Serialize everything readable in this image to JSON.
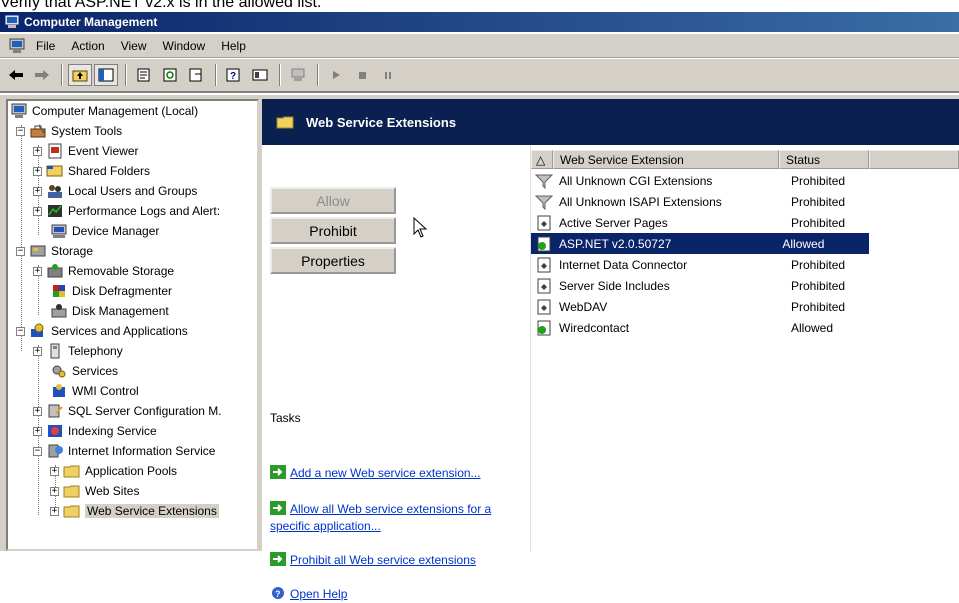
{
  "caption": "Verify that ASP.NET v2.x is in the allowed list.",
  "window": {
    "title": "Computer Management"
  },
  "menu": [
    "File",
    "Action",
    "View",
    "Window",
    "Help"
  ],
  "tree": {
    "root": "Computer Management (Local)",
    "system_tools": "System Tools",
    "event_viewer": "Event Viewer",
    "shared_folders": "Shared Folders",
    "local_users": "Local Users and Groups",
    "perf_logs": "Performance Logs and Alert:",
    "device_manager": "Device Manager",
    "storage": "Storage",
    "removable_storage": "Removable Storage",
    "disk_defrag": "Disk Defragmenter",
    "disk_mgmt": "Disk Management",
    "services_apps": "Services and Applications",
    "telephony": "Telephony",
    "services": "Services",
    "wmi": "WMI Control",
    "sql": "SQL Server Configuration M.",
    "indexing": "Indexing Service",
    "iis": "Internet Information Service",
    "app_pools": "Application Pools",
    "web_sites": "Web Sites",
    "web_ext": "Web Service Extensions"
  },
  "pane": {
    "title": "Web Service Extensions",
    "buttons": {
      "allow": "Allow",
      "prohibit": "Prohibit",
      "properties": "Properties"
    },
    "tasks_label": "Tasks",
    "tasks": {
      "add": "Add a new Web service extension...",
      "allow_all_1": "Allow all Web service extensions for a",
      "allow_all_2": "specific application...",
      "prohibit_all": "Prohibit all Web service extensions",
      "help": "Open Help"
    }
  },
  "list": {
    "columns": {
      "name": "Web Service Extension",
      "status": "Status"
    },
    "rows": [
      {
        "name": "All Unknown CGI Extensions",
        "status": "Prohibited"
      },
      {
        "name": "All Unknown ISAPI Extensions",
        "status": "Prohibited"
      },
      {
        "name": "Active Server Pages",
        "status": "Prohibited"
      },
      {
        "name": "ASP.NET v2.0.50727",
        "status": "Allowed"
      },
      {
        "name": "Internet Data Connector",
        "status": "Prohibited"
      },
      {
        "name": "Server Side Includes",
        "status": "Prohibited"
      },
      {
        "name": "WebDAV",
        "status": "Prohibited"
      },
      {
        "name": "Wiredcontact",
        "status": "Allowed"
      }
    ],
    "selected_row": "ASP.NET v2.0.50727"
  },
  "colors": {
    "title_bar": "#0a246a",
    "header_band": "#0a2050",
    "selection": "#0a246a",
    "link": "#0033cc",
    "chrome": "#d4d0c8"
  }
}
